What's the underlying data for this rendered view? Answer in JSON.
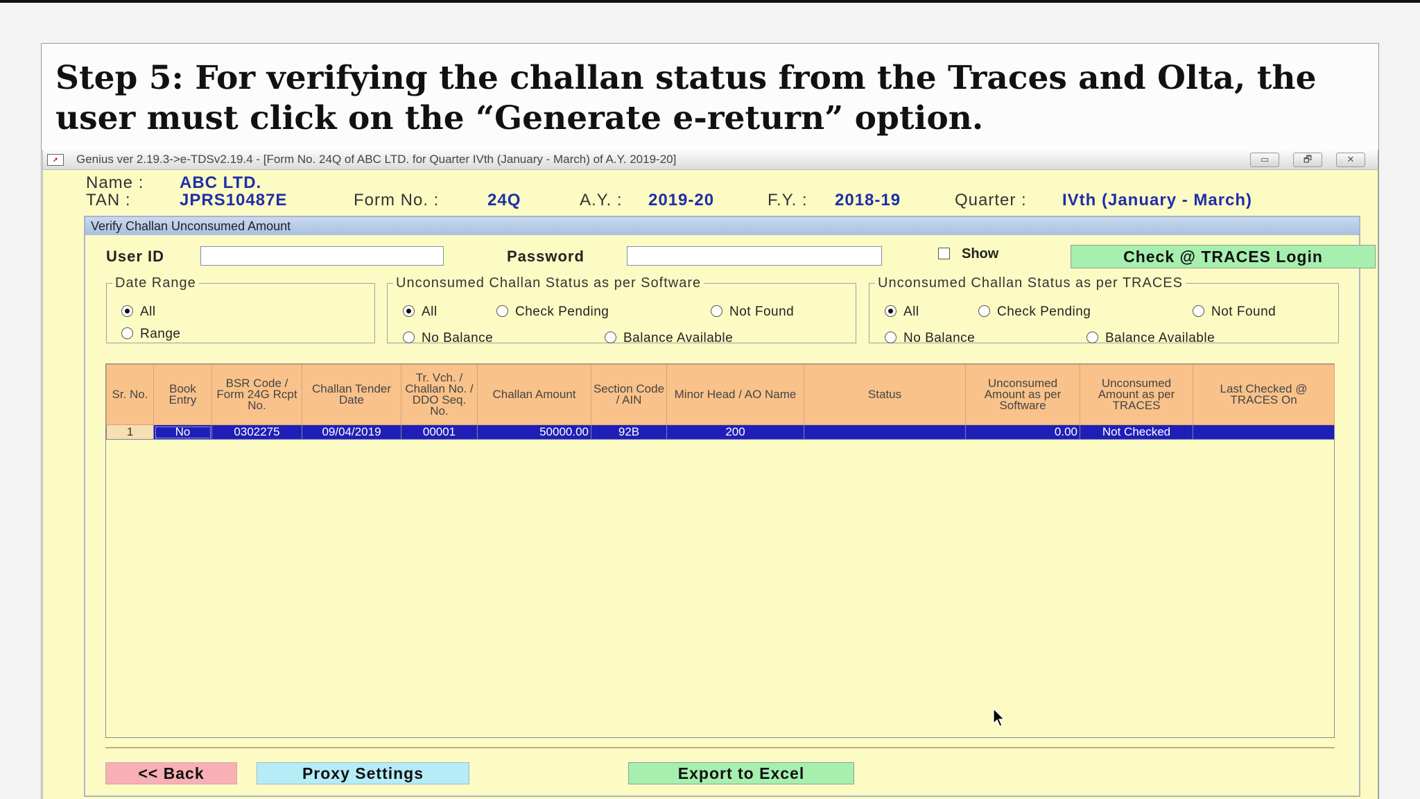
{
  "slide": {
    "step_text": "Step 5: For verifying the challan status from the Traces and Olta, the user must click on the “Generate e-return” option."
  },
  "window": {
    "title": "Genius ver 2.19.3->e-TDSv2.19.4 - [Form No. 24Q of ABC LTD. for Quarter IVth (January - March) of A.Y. 2019-20]",
    "controls": {
      "minimize": "▭",
      "restore": "🗗",
      "close": "✕"
    }
  },
  "header": {
    "name_label": "Name :",
    "name_value": "ABC LTD.",
    "tan_label": "TAN :",
    "tan_value": "JPRS10487E",
    "form_label": "Form No. :",
    "form_value": "24Q",
    "ay_label": "A.Y. :",
    "ay_value": "2019-20",
    "fy_label": "F.Y. :",
    "fy_value": "2018-19",
    "quarter_label": "Quarter :",
    "quarter_value": "IVth (January - March)"
  },
  "dialog": {
    "title": "Verify Challan Unconsumed Amount",
    "user_id_label": "User ID",
    "user_id_value": "",
    "password_label": "Password",
    "password_value": "",
    "show_label": "Show",
    "show_checked": false,
    "traces_login_button": "Check @ TRACES Login",
    "date_range": {
      "legend": "Date Range",
      "options": [
        "All",
        "Range"
      ],
      "selected": "All"
    },
    "software_status": {
      "legend": "Unconsumed Challan Status as per Software",
      "options": [
        "All",
        "Check Pending",
        "Not Found",
        "No Balance",
        "Balance Available"
      ],
      "selected": "All"
    },
    "traces_status": {
      "legend": "Unconsumed Challan Status as per TRACES",
      "options": [
        "All",
        "Check Pending",
        "Not Found",
        "No Balance",
        "Balance Available"
      ],
      "selected": "All"
    },
    "table": {
      "columns": [
        "Sr. No.",
        "Book Entry",
        "BSR Code / Form 24G Rcpt No.",
        "Challan Tender Date",
        "Tr. Vch. / Challan No. / DDO Seq. No.",
        "Challan Amount",
        "Section Code / AIN",
        "Minor Head / AO Name",
        "Status",
        "Unconsumed Amount as per Software",
        "Unconsumed Amount as per TRACES",
        "Last Checked @ TRACES On"
      ],
      "rows": [
        [
          "1",
          "No",
          "0302275",
          "09/04/2019",
          "00001",
          "50000.00",
          "92B",
          "200",
          "",
          "0.00",
          "Not Checked",
          ""
        ]
      ]
    },
    "buttons": {
      "back": "<< Back",
      "proxy": "Proxy Settings",
      "export": "Export to Excel"
    }
  },
  "colors": {
    "window_bg": "#fdfbc4",
    "header_value": "#1f2ea8",
    "table_header": "#f9c28a",
    "selected_row": "#1f1fb8",
    "traces_button": "#a7efae",
    "back_button": "#f8b0b4",
    "proxy_button": "#b5ecf6"
  }
}
